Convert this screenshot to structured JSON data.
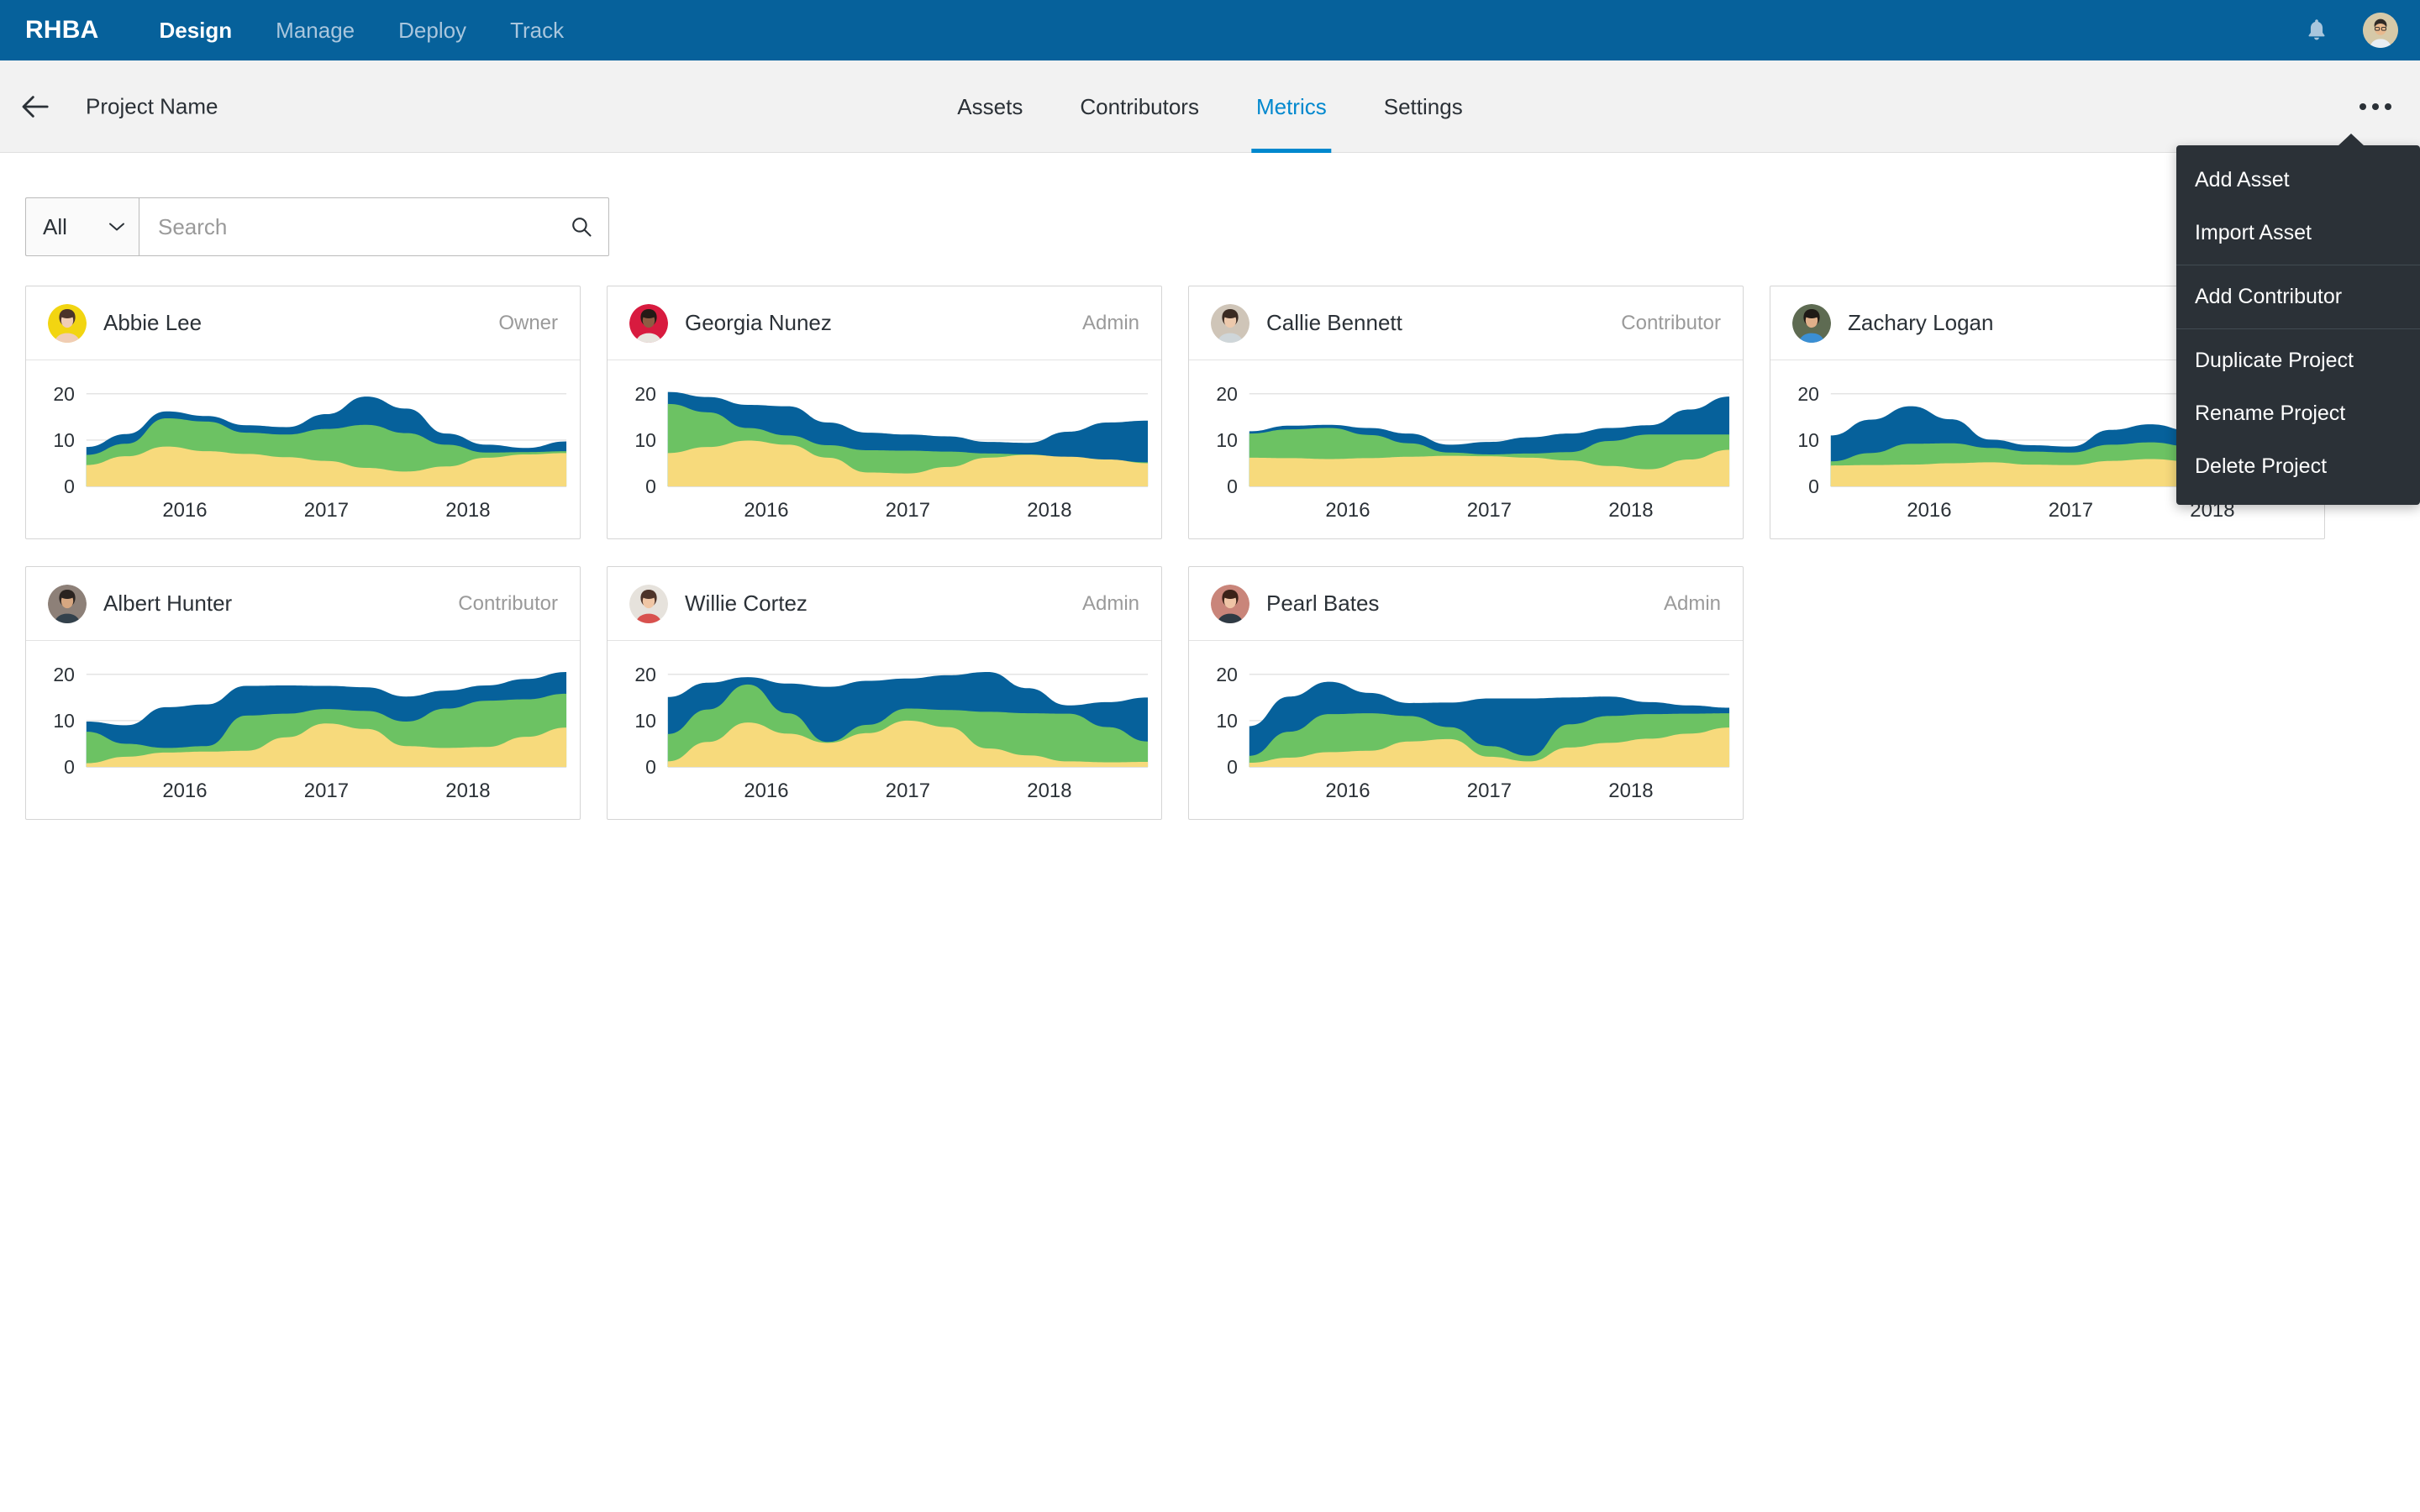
{
  "topbar": {
    "brand": "RHBA",
    "nav": [
      {
        "label": "Design",
        "active": true
      },
      {
        "label": "Manage",
        "active": false
      },
      {
        "label": "Deploy",
        "active": false
      },
      {
        "label": "Track",
        "active": false
      }
    ],
    "notification_icon": "bell-icon",
    "avatar_icon": "user-avatar",
    "bg_color": "#06619b"
  },
  "subbar": {
    "back_icon": "back-arrow-icon",
    "project_title": "Project Name",
    "tabs": [
      {
        "label": "Assets",
        "active": false
      },
      {
        "label": "Contributors",
        "active": false
      },
      {
        "label": "Metrics",
        "active": true
      },
      {
        "label": "Settings",
        "active": false
      }
    ],
    "overflow_icon": "kebab-menu-icon",
    "active_color": "#0088ce"
  },
  "menu": {
    "groups": [
      [
        "Add Asset",
        "Import Asset"
      ],
      [
        "Add Contributor"
      ],
      [
        "Duplicate Project",
        "Rename Project",
        "Delete Project"
      ]
    ],
    "bg_color": "#2b3137"
  },
  "filterbar": {
    "select_value": "All",
    "select_icon": "chevron-down-icon",
    "search_placeholder": "Search",
    "search_value": "",
    "search_icon": "search-icon"
  },
  "chart_data": {
    "type": "area",
    "stacked": true,
    "x": [
      2016,
      2017,
      2018
    ],
    "xlabel": "",
    "ylabel": "",
    "ylim": [
      0,
      20
    ],
    "yticks": [
      0,
      10,
      20
    ],
    "grid": true,
    "legend": "none",
    "series_names": [
      "Yellow",
      "Green",
      "Blue"
    ],
    "series_colors": [
      "#f7da7c",
      "#6cc263",
      "#06619b"
    ],
    "charts": [
      {
        "owner": "Abbie Lee",
        "yellow": [
          4.6,
          6.5,
          8.6,
          7.6,
          7.0,
          6.3,
          5.5,
          4.0,
          3.2,
          4.3,
          6.2,
          6.9,
          7.2
        ],
        "green": [
          6.8,
          9.2,
          14.7,
          14.0,
          11.6,
          11.2,
          12.4,
          13.3,
          11.5,
          9.0,
          7.3,
          7.4,
          7.6
        ],
        "blue": [
          8.5,
          11.3,
          16.2,
          15.2,
          13.2,
          12.8,
          15.6,
          19.4,
          16.8,
          11.4,
          9.0,
          8.3,
          9.7
        ]
      },
      {
        "owner": "Georgia Nunez",
        "yellow": [
          7.2,
          8.5,
          9.9,
          9.0,
          6.2,
          3.0,
          2.8,
          4.2,
          6.2,
          6.8,
          6.4,
          5.8,
          5.0
        ],
        "green": [
          17.8,
          16.0,
          12.6,
          11.0,
          8.9,
          7.8,
          7.7,
          7.5,
          7.1,
          6.9,
          6.3,
          5.7,
          5.2
        ],
        "blue": [
          20.4,
          19.3,
          17.6,
          17.3,
          13.8,
          11.6,
          11.2,
          10.8,
          9.6,
          9.4,
          11.8,
          13.8,
          14.2
        ]
      },
      {
        "owner": "Callie Bennett",
        "yellow": [
          6.2,
          6.1,
          5.9,
          6.1,
          6.4,
          6.6,
          6.5,
          6.2,
          5.6,
          4.4,
          3.7,
          5.8,
          7.9
        ],
        "green": [
          11.4,
          12.3,
          12.6,
          11.1,
          9.3,
          7.3,
          6.9,
          7.1,
          7.4,
          9.8,
          11.2,
          11.2,
          11.2
        ],
        "blue": [
          11.9,
          13.1,
          13.3,
          12.6,
          11.4,
          9.0,
          9.6,
          10.6,
          11.4,
          12.6,
          13.2,
          16.6,
          19.4
        ]
      },
      {
        "owner": "Zachary Logan",
        "yellow": [
          4.5,
          4.6,
          4.7,
          5.0,
          5.2,
          4.7,
          4.6,
          5.5,
          5.9,
          5.4,
          4.9,
          5.6,
          6.4
        ],
        "green": [
          5.4,
          7.2,
          9.2,
          9.3,
          8.3,
          7.5,
          7.3,
          9.0,
          9.5,
          8.6,
          7.7,
          8.3,
          9.3
        ],
        "blue": [
          11.0,
          14.4,
          17.3,
          14.5,
          10.1,
          8.9,
          8.6,
          12.2,
          13.4,
          12.0,
          10.4,
          10.9,
          11.6
        ]
      },
      {
        "owner": "Albert Hunter",
        "yellow": [
          0.8,
          2.2,
          3.1,
          3.3,
          3.5,
          6.4,
          9.4,
          8.2,
          4.5,
          4.1,
          4.3,
          6.5,
          8.5
        ],
        "green": [
          7.6,
          5.0,
          4.1,
          4.5,
          11.1,
          11.5,
          12.5,
          12.1,
          9.8,
          12.6,
          14.3,
          14.6,
          15.8
        ],
        "blue": [
          9.8,
          9.0,
          12.9,
          13.5,
          17.5,
          17.6,
          17.5,
          17.2,
          15.2,
          16.5,
          17.6,
          19.0,
          20.5
        ]
      },
      {
        "owner": "Willie Cortez",
        "yellow": [
          1.2,
          5.4,
          9.6,
          7.2,
          5.2,
          7.3,
          10.0,
          8.6,
          4.0,
          2.5,
          1.2,
          1.0,
          1.1
        ],
        "green": [
          7.1,
          12.4,
          17.8,
          11.6,
          5.4,
          9.1,
          12.6,
          12.3,
          11.9,
          11.6,
          11.5,
          8.6,
          5.5
        ],
        "blue": [
          15.1,
          18.2,
          19.4,
          18.0,
          17.3,
          18.6,
          19.1,
          19.8,
          20.5,
          17.0,
          13.3,
          14.0,
          15.0
        ]
      },
      {
        "owner": "Pearl Bates",
        "yellow": [
          0.9,
          2.0,
          3.2,
          3.5,
          5.5,
          6.0,
          2.2,
          1.2,
          4.2,
          5.2,
          6.1,
          7.2,
          8.5
        ],
        "green": [
          2.4,
          7.6,
          11.4,
          11.6,
          11.0,
          8.6,
          4.5,
          2.4,
          9.2,
          11.0,
          11.4,
          11.5,
          11.6
        ],
        "blue": [
          8.8,
          15.2,
          18.4,
          16.0,
          13.8,
          13.9,
          14.8,
          14.8,
          15.0,
          15.2,
          14.0,
          13.3,
          12.8
        ]
      }
    ]
  },
  "cards": [
    {
      "name": "Abbie Lee",
      "role": "Owner",
      "avatar": "avatar-abbie-lee",
      "avatar_bg": "#f2d511",
      "chart_index": 0
    },
    {
      "name": "Georgia Nunez",
      "role": "Admin",
      "avatar": "avatar-georgia-nunez",
      "avatar_bg": "#d81b3f",
      "chart_index": 1
    },
    {
      "name": "Callie Bennett",
      "role": "Contributor",
      "avatar": "avatar-callie-bennett",
      "avatar_bg": "#cfc5b8",
      "chart_index": 2
    },
    {
      "name": "Zachary Logan",
      "role": "",
      "avatar": "avatar-zachary-logan",
      "avatar_bg": "#5e6b52",
      "chart_index": 3
    },
    {
      "name": "Albert Hunter",
      "role": "Contributor",
      "avatar": "avatar-albert-hunter",
      "avatar_bg": "#8d8078",
      "chart_index": 4
    },
    {
      "name": "Willie Cortez",
      "role": "Admin",
      "avatar": "avatar-willie-cortez",
      "avatar_bg": "#e6e2dc",
      "chart_index": 5
    },
    {
      "name": "Pearl Bates",
      "role": "Admin",
      "avatar": "avatar-pearl-bates",
      "avatar_bg": "#c9857a",
      "chart_index": 6
    }
  ]
}
